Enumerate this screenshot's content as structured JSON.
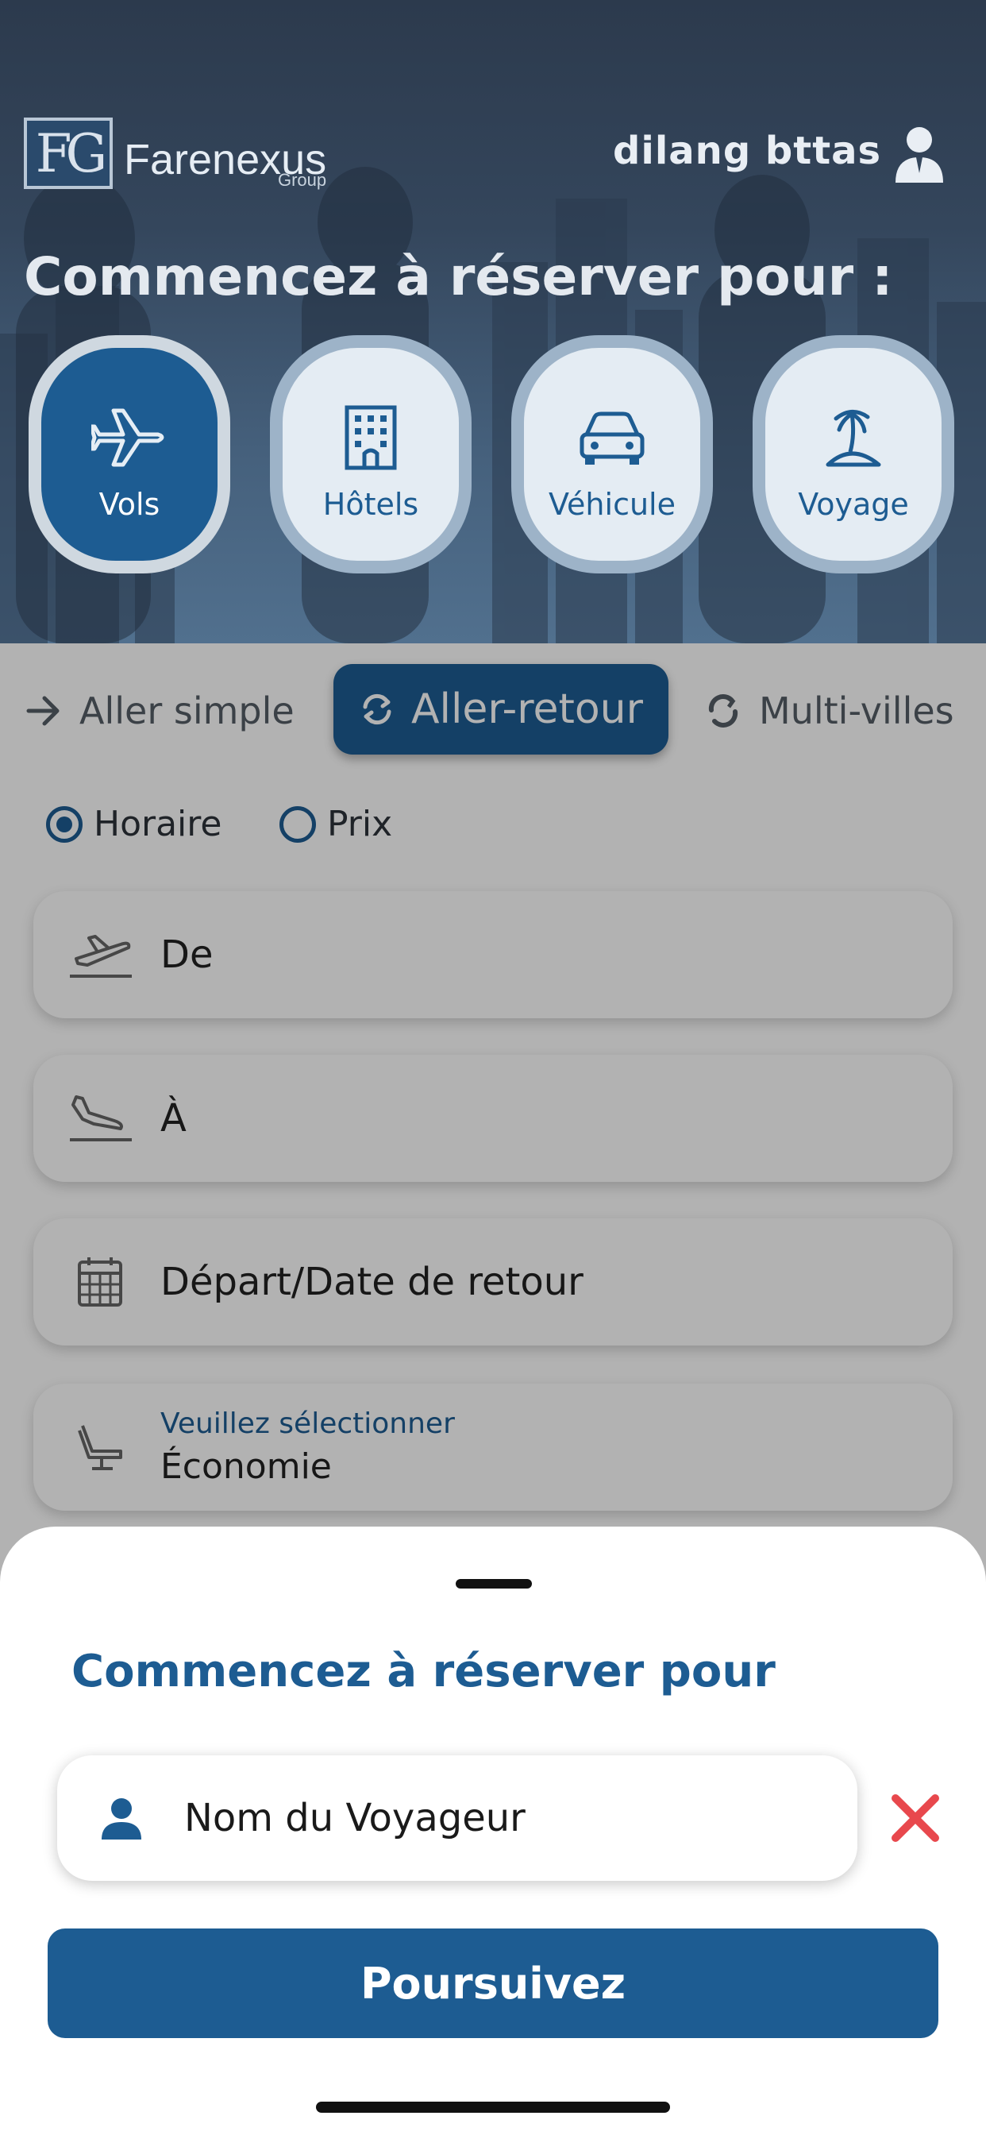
{
  "header": {
    "logo_mark": "FG",
    "logo_name": "Farenexus",
    "logo_sub": "Group",
    "user_name": "dilang  bttas",
    "title": "Commencez à réserver pour :"
  },
  "categories": [
    {
      "label": "Vols",
      "icon": "airplane-icon",
      "active": true
    },
    {
      "label": "Hôtels",
      "icon": "hotel-building-icon",
      "active": false
    },
    {
      "label": "Véhicule",
      "icon": "car-icon",
      "active": false
    },
    {
      "label": "Voyage",
      "icon": "island-icon",
      "active": false
    }
  ],
  "trip_types": {
    "one_way": "Aller simple",
    "round_trip": "Aller-retour",
    "multi_city": "Multi-villes",
    "selected": "Aller-retour"
  },
  "sort": {
    "schedule": "Horaire",
    "price": "Prix",
    "selected": "Horaire"
  },
  "fields": {
    "from": "De",
    "to": "À",
    "dates": "Départ/Date de retour",
    "cabin_label": "Veuillez sélectionner",
    "cabin_value": "Économie"
  },
  "sheet": {
    "title": "Commencez à réserver pour",
    "traveler_placeholder": "Nom du Voyageur",
    "continue_label": "Poursuivez"
  },
  "colors": {
    "brand": "#1d5c92",
    "clear": "#e8484d"
  }
}
